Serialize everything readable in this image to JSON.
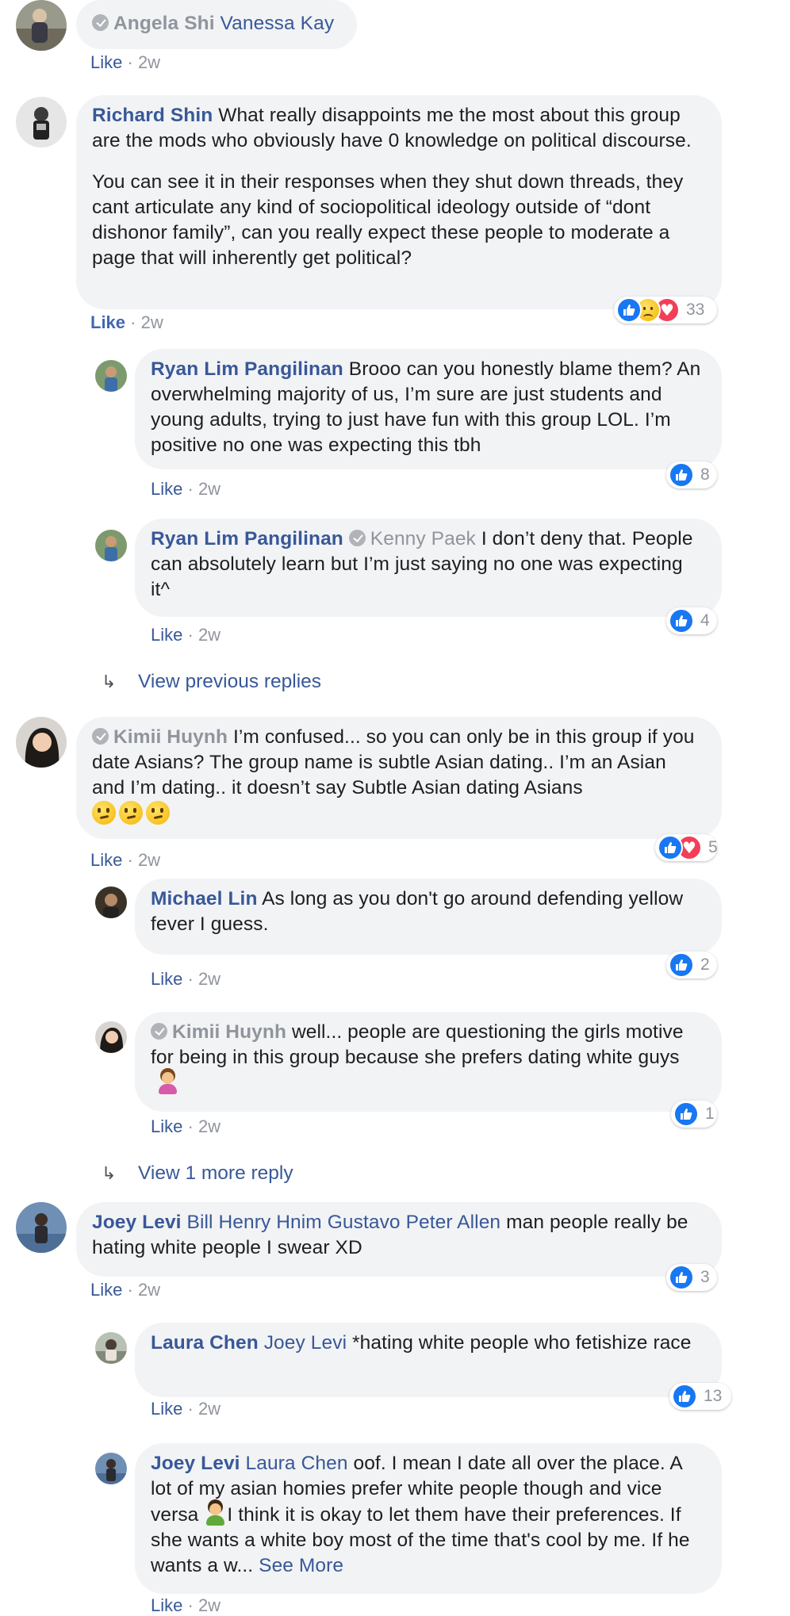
{
  "comments": [
    {
      "author": "Angela Shi",
      "tag": "Vanessa Kay",
      "like": "Like",
      "time": "2w"
    },
    {
      "author": "Richard Shin",
      "text_p1": "What really disappoints me the most about this group are the mods who obviously have 0 knowledge on political discourse.",
      "text_p2": "You can see it in their responses when they shut down threads, they cant articulate any kind of sociopolitical ideology outside of “dont dishonor family”, can you really expect these people to moderate a page that will inherently get political?",
      "like": "Like",
      "time": "2w",
      "reaction_count": "33",
      "reaction_types": [
        "like",
        "sad",
        "love"
      ]
    },
    {
      "author": "Ryan Lim Pangilinan",
      "text": "Brooo can you honestly blame them? An overwhelming majority of us, I’m sure are just students and young adults, trying to just have fun with this group LOL. I’m positive no one was expecting this tbh",
      "like": "Like",
      "time": "2w",
      "reaction_count": "8"
    },
    {
      "author": "Ryan Lim Pangilinan",
      "tag": "Kenny Paek",
      "text": "I don’t deny that. People can absolutely learn but I’m just saying no one was expecting it^",
      "like": "Like",
      "time": "2w",
      "reaction_count": "4"
    },
    {
      "author": "Kimii Huynh",
      "text": "I’m confused... so you can only be in this group if you date Asians? The group name is subtle Asian dating.. I’m an Asian and I’m dating.. it doesn’t say Subtle Asian dating Asians",
      "like": "Like",
      "time": "2w",
      "reaction_count": "5",
      "reaction_types": [
        "like",
        "love"
      ]
    },
    {
      "author": "Michael Lin",
      "text": "As long as you don't go around defending yellow fever I guess.",
      "like": "Like",
      "time": "2w",
      "reaction_count": "2"
    },
    {
      "author": "Kimii Huynh",
      "text": "well... people are questioning the girls motive for being in this group because she prefers dating white guys",
      "like": "Like",
      "time": "2w",
      "reaction_count": "1"
    },
    {
      "author": "Joey Levi",
      "tag": "Bill Henry Hnim Gustavo Peter Allen",
      "text": "man people really be hating white people I swear XD",
      "like": "Like",
      "time": "2w",
      "reaction_count": "3"
    },
    {
      "author": "Laura Chen",
      "tag": "Joey Levi",
      "text": "*hating white people who fetishize race",
      "like": "Like",
      "time": "2w",
      "reaction_count": "13"
    },
    {
      "author": "Joey Levi",
      "tag": "Laura Chen",
      "text_before_emoji": "oof. I mean I date all over the place. A lot of my asian homies prefer white people though and vice versa",
      "text_after_emoji": "I think it is okay to let them have their preferences. If she wants a white boy most of the time that's cool by me. If he wants a w...",
      "see_more": "See More",
      "like": "Like",
      "time": "2w"
    }
  ],
  "view_previous_replies": "View previous replies",
  "view_more_reply": "View 1 more reply",
  "separator": "·",
  "colors": {
    "name_blue": "#385898",
    "bubble_gray": "#f2f3f5",
    "meta_gray": "#90949c",
    "like_blue": "#1877f2",
    "love_red": "#f33e58"
  }
}
